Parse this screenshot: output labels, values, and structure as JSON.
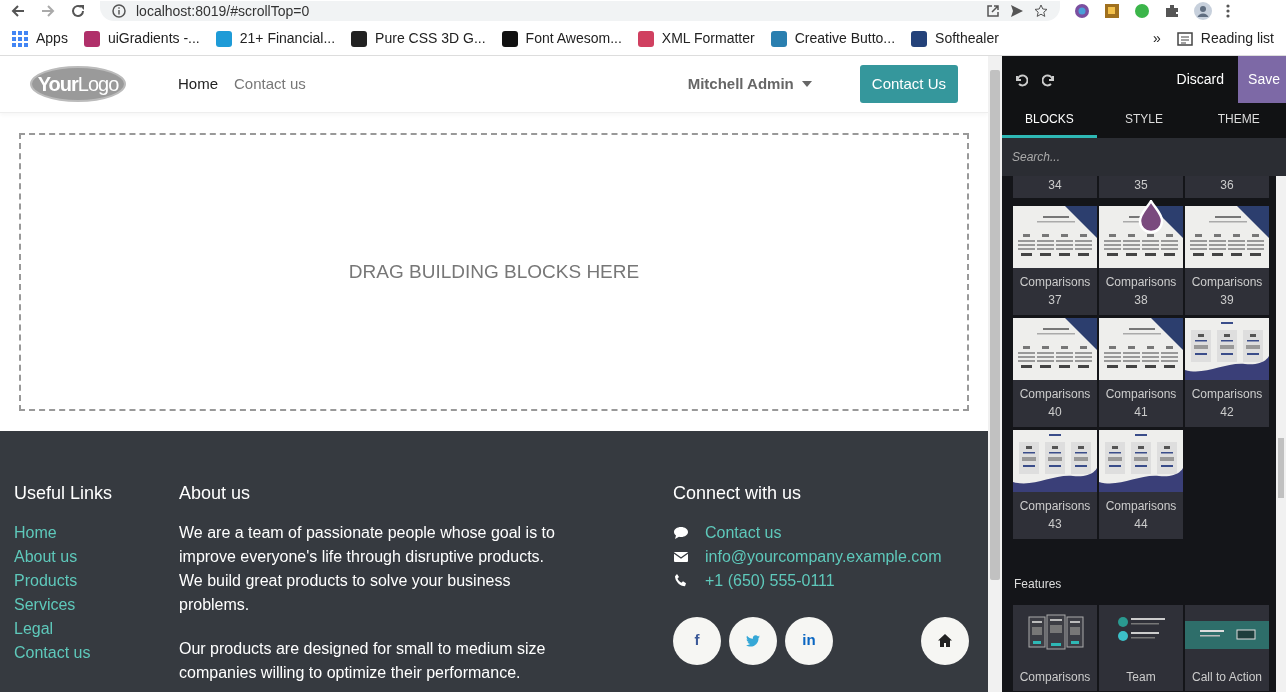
{
  "browser": {
    "url": "localhost:8019/#scrollTop=0"
  },
  "bookmarks": [
    {
      "label": "Apps",
      "color": "#4285f4"
    },
    {
      "label": "uiGradients -...",
      "color": "#b0306a"
    },
    {
      "label": "21+ Financial...",
      "color": "#1e9bd7"
    },
    {
      "label": "Pure CSS 3D G...",
      "color": "#222222"
    },
    {
      "label": "Font Awesom...",
      "color": "#111111"
    },
    {
      "label": "XML Formatter",
      "color": "#d04060"
    },
    {
      "label": "Creative Butto...",
      "color": "#2a7fb0"
    },
    {
      "label": "Softhealer",
      "color": "#24427a"
    }
  ],
  "bookmarks_more": "»",
  "reading_list": "Reading list",
  "site": {
    "logo": "**Your**Logo",
    "nav": [
      {
        "label": "Home",
        "selected": true
      },
      {
        "label": "Contact us",
        "selected": false
      }
    ],
    "user": "Mitchell Admin",
    "cta": "Contact Us",
    "dropzone": "DRAG BUILDING BLOCKS HERE"
  },
  "footer": {
    "links_title": "Useful Links",
    "links": [
      "Home",
      "About us",
      "Products",
      "Services",
      "Legal",
      "Contact us"
    ],
    "about_title": "About us",
    "about": [
      "We are a team of passionate people whose goal is to improve everyone's life through disruptive products. We build great products to solve your business problems.",
      "Our products are designed for small to medium size companies willing to optimize their performance."
    ],
    "connect_title": "Connect with us",
    "contacts": [
      {
        "kind": "chat",
        "label": "Contact us"
      },
      {
        "kind": "mail",
        "label": "info@yourcompany.example.com"
      },
      {
        "kind": "phone",
        "label": "+1 (650) 555-0111"
      }
    ],
    "social": [
      {
        "kind": "facebook",
        "glyph": "f"
      },
      {
        "kind": "twitter"
      },
      {
        "kind": "linkedin",
        "glyph": "in"
      },
      {
        "kind": "home"
      }
    ]
  },
  "editor": {
    "discard": "Discard",
    "save": "Save",
    "tabs": [
      {
        "label": "BLOCKS",
        "selected": true
      },
      {
        "label": "STYLE",
        "selected": false
      },
      {
        "label": "THEME",
        "selected": false
      }
    ],
    "search_placeholder": "Search...",
    "partial_row": [
      "34",
      "35",
      "36"
    ],
    "blocks": [
      {
        "label": "Comparisons 37",
        "kind": "corner"
      },
      {
        "label": "Comparisons 38",
        "kind": "corner"
      },
      {
        "label": "Comparisons 39",
        "kind": "corner"
      },
      {
        "label": "Comparisons 40",
        "kind": "corner"
      },
      {
        "label": "Comparisons 41",
        "kind": "corner"
      },
      {
        "label": "Comparisons 42",
        "kind": "wave"
      },
      {
        "label": "Comparisons 43",
        "kind": "wave"
      },
      {
        "label": "Comparisons 44",
        "kind": "wave"
      }
    ],
    "section": "Features",
    "features": [
      {
        "label": "Comparisons",
        "kind": "columns"
      },
      {
        "label": "Team",
        "kind": "team"
      },
      {
        "label": "Call to Action",
        "kind": "cta"
      }
    ]
  }
}
